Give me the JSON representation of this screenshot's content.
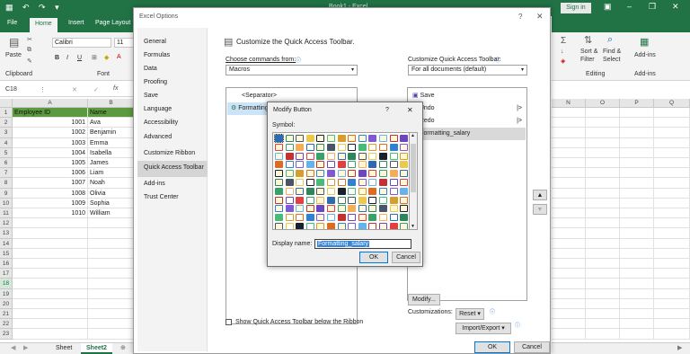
{
  "excel": {
    "window_title": "Book1 - Excel",
    "sign_in": "Sign in",
    "tabs": [
      "File",
      "Home",
      "Insert",
      "Page Layout"
    ],
    "ribbon": {
      "paste": "Paste",
      "clipboard": "Clipboard",
      "font_name": "Calibri",
      "font_size": "11",
      "font_group": "Font",
      "bold": "B",
      "italic": "I",
      "underline": "U",
      "sort_filter": "Sort &",
      "sort_filter2": "Filter",
      "find_select": "Find &",
      "find_select2": "Select",
      "editing": "Editing",
      "add_ins": "Add-ins",
      "add_ins_group": "Add-ins"
    },
    "name_box": "C18",
    "fx": "fx",
    "columns_left": [
      "A",
      "B"
    ],
    "columns_right": [
      "N",
      "O",
      "P",
      "Q"
    ],
    "rows": [
      "1",
      "2",
      "3",
      "4",
      "5",
      "6",
      "7",
      "8",
      "9",
      "10",
      "11",
      "12",
      "13",
      "14",
      "15",
      "16",
      "17",
      "18",
      "19",
      "20",
      "21",
      "22",
      "23"
    ],
    "table_header": [
      "Employee ID",
      "Name"
    ],
    "table_rows": [
      [
        "1001",
        "Ava"
      ],
      [
        "1002",
        "Benjamin"
      ],
      [
        "1003",
        "Emma"
      ],
      [
        "1004",
        "Isabella"
      ],
      [
        "1005",
        "James"
      ],
      [
        "1006",
        "Liam"
      ],
      [
        "1007",
        "Noah"
      ],
      [
        "1008",
        "Olivia"
      ],
      [
        "1009",
        "Sophia"
      ],
      [
        "1010",
        "William"
      ]
    ],
    "sheet_tabs": [
      "Sheet",
      "Sheet2"
    ],
    "active_sheet": "Sheet2",
    "accent": "#217346",
    "header_fill": "#5b9a3e"
  },
  "options_dialog": {
    "title": "Excel Options",
    "help": "?",
    "close": "✕",
    "nav": [
      "General",
      "Formulas",
      "Data",
      "Proofing",
      "Save",
      "Language",
      "Accessibility",
      "Advanced",
      "Customize Ribbon",
      "Quick Access Toolbar",
      "Add-ins",
      "Trust Center"
    ],
    "selected_nav": "Quick Access Toolbar",
    "heading": "Customize the Quick Access Toolbar.",
    "choose_label": "Choose commands from:",
    "choose_value": "Macros",
    "customize_label": "Customize Quick Access Toolbar:",
    "customize_value": "For all documents (default)",
    "left_list": [
      "<Separator>",
      "Formatting_salary"
    ],
    "right_list": [
      "Save",
      "Undo",
      "Redo",
      "Formatting_salary"
    ],
    "show_below": "Show Quick Access Toolbar below the Ribbon",
    "modify_btn": "Modify...",
    "customizations": "Customizations:",
    "reset": "Reset ▾",
    "import_export": "Import/Export ▾",
    "ok": "OK",
    "cancel": "Cancel"
  },
  "modify_dialog": {
    "title": "Modify Button",
    "help": "?",
    "close": "✕",
    "symbol_label": "Symbol:",
    "display_name_label": "Display name:",
    "display_name_value": "Formatting_salary",
    "ok": "OK",
    "cancel": "Cancel"
  }
}
